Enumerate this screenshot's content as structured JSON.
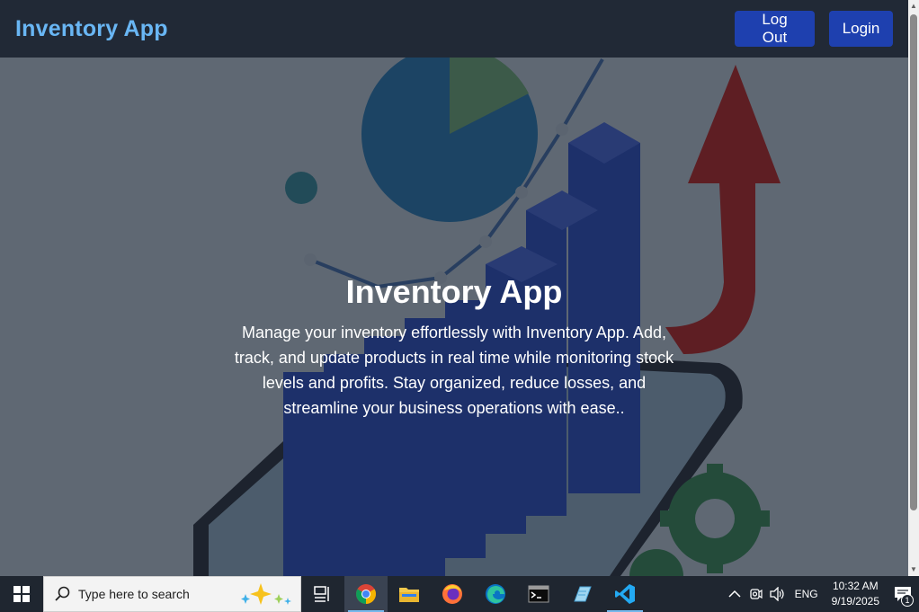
{
  "navbar": {
    "brand": "Inventory App",
    "logout_label": "Log Out",
    "login_label": "Login"
  },
  "hero": {
    "title": "Inventory App",
    "description": "Manage your inventory effortlessly with Inventory App. Add, track, and update products in real time while monitoring stock levels and profits. Stay organized, reduce losses, and streamline your business operations with ease.."
  },
  "taskbar": {
    "search_placeholder": "Type here to search",
    "apps": [
      "task-view",
      "chrome",
      "file-explorer",
      "firefox",
      "edge",
      "terminal",
      "notepad",
      "vscode"
    ],
    "language": "ENG",
    "time": "10:32 AM",
    "date": "9/19/2025",
    "notification_count": "1"
  },
  "colors": {
    "brand": "#69b6f4",
    "button": "#1e40af",
    "navbar_bg": "#212936",
    "taskbar_bg": "#1f2630"
  }
}
